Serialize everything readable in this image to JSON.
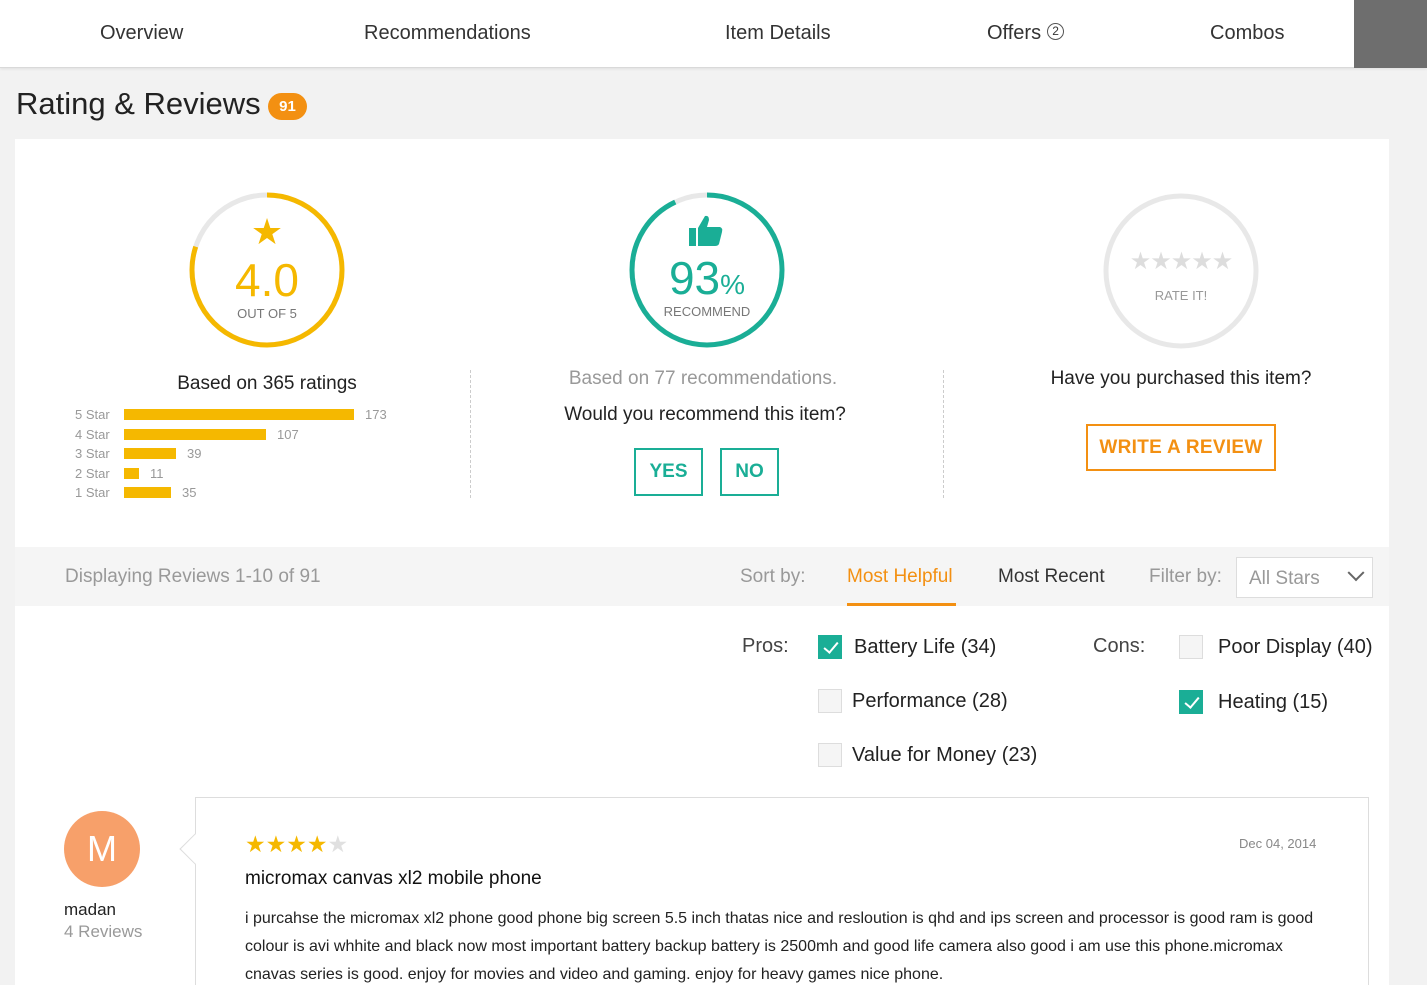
{
  "nav": {
    "tabs": [
      {
        "label": "Overview"
      },
      {
        "label": "Recommendations"
      },
      {
        "label": "Item Details"
      },
      {
        "label": "Offers",
        "badge": "2"
      },
      {
        "label": "Combos"
      }
    ]
  },
  "header": {
    "title": "Rating & Reviews",
    "count": "91"
  },
  "rating": {
    "score": "4.0",
    "out_of": "OUT OF 5",
    "score_fraction": 0.8,
    "caption": "Based on 365 ratings",
    "breakdown": [
      {
        "label": "5 Star",
        "count": "173",
        "value": 173
      },
      {
        "label": "4 Star",
        "count": "107",
        "value": 107
      },
      {
        "label": "3 Star",
        "count": "39",
        "value": 39
      },
      {
        "label": "2 Star",
        "count": "11",
        "value": 11
      },
      {
        "label": "1 Star",
        "count": "35",
        "value": 35
      }
    ]
  },
  "recommend": {
    "percent": "93",
    "percent_sign": "%",
    "percent_fraction": 0.93,
    "label": "RECOMMEND",
    "caption": "Based on 77 recommendations.",
    "question": "Would you recommend this item?",
    "yes_label": "YES",
    "no_label": "NO"
  },
  "rate": {
    "label": "RATE IT!",
    "question": "Have you purchased this item?",
    "write_label": "WRITE A REVIEW"
  },
  "sortbar": {
    "displaying": "Displaying Reviews 1-10 of 91",
    "sort_label": "Sort by:",
    "sort_active": "Most Helpful",
    "sort_other": "Most Recent",
    "filter_label": "Filter by:",
    "filter_value": "All Stars"
  },
  "pros": {
    "label": "Pros:",
    "items": [
      {
        "text": "Battery Life (34)",
        "checked": true
      },
      {
        "text": "Performance (28)",
        "checked": false
      },
      {
        "text": "Value for Money (23)",
        "checked": false
      }
    ]
  },
  "cons": {
    "label": "Cons:",
    "items": [
      {
        "text": "Poor Display (40)",
        "checked": false
      },
      {
        "text": "Heating (15)",
        "checked": true
      }
    ]
  },
  "review": {
    "avatar_letter": "M",
    "author": "madan",
    "author_reviews": "4 Reviews",
    "stars": 4,
    "date": "Dec 04, 2014",
    "title": "micromax canvas xl2 mobile phone",
    "body": "i purcahse the micromax xl2 phone good phone big screen 5.5  inch thatas nice and resloution is qhd and ips screen and processor is good ram is good colour is avi whhite and black now most important battery backup battery is 2500mh and good life camera also good i am use this phone.micromax cnavas series is good. enjoy for movies and video and gaming. enjoy for heavy games nice phone."
  },
  "colors": {
    "accent_orange": "#f39012",
    "star_yellow": "#f5b800",
    "teal": "#1aae96",
    "avatar": "#f7a06a"
  }
}
